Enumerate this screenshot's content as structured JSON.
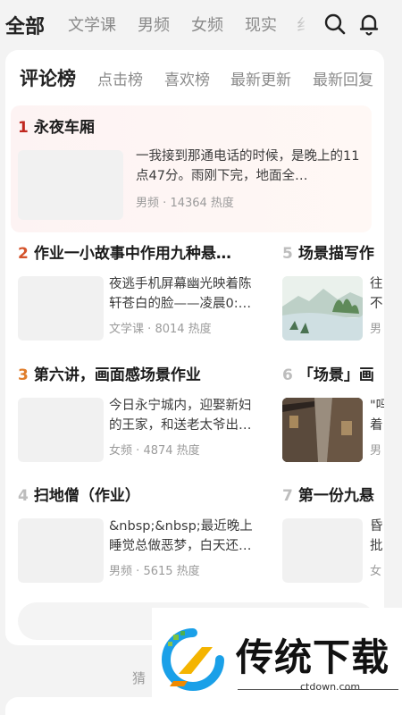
{
  "top_nav": {
    "categories": [
      "全部",
      "文学课",
      "男频",
      "女频",
      "现实",
      "纟"
    ]
  },
  "ranking": {
    "tabs": [
      "评论榜",
      "点击榜",
      "喜欢榜",
      "最新更新",
      "最新回复"
    ],
    "items": [
      {
        "rank": "1",
        "title": "永夜车厢",
        "desc": "一我接到那通电话的时候，是晚上的11点47分。雨刚下完，地面全…",
        "category": "男频",
        "heat": "14364 热度",
        "rank_color": "#c0271f"
      },
      {
        "rank": "2",
        "title": "作业一小故事中作用九种悬…",
        "desc": "夜逃手机屏幕幽光映着陈轩苍白的脸——凌晨0:…",
        "category": "文学课",
        "heat": "8014 热度",
        "rank_color": "#d4532b"
      },
      {
        "rank": "3",
        "title": "第六讲，画面感场景作业",
        "desc": "今日永宁城内，迎娶新妇的王家，和送老太爷出…",
        "category": "女频",
        "heat": "4874 热度",
        "rank_color": "#e07d2a"
      },
      {
        "rank": "4",
        "title": "扫地僧（作业）",
        "desc": "&nbsp;&nbsp;最近晚上睡觉总做恶梦，白天还…",
        "category": "男频",
        "heat": "5615 热度",
        "rank_color": "#bdbdbd"
      },
      {
        "rank": "5",
        "title": "场景描写作",
        "desc": "往不",
        "category": "男",
        "heat": "",
        "rank_color": "#bdbdbd"
      },
      {
        "rank": "6",
        "title": "「场景」画",
        "desc": "\"吗着",
        "category": "男",
        "heat": "",
        "rank_color": "#bdbdbd"
      },
      {
        "rank": "7",
        "title": "第一份九悬",
        "desc": "昏批",
        "category": "女",
        "heat": "",
        "rank_color": "#bdbdbd"
      }
    ],
    "separator": "·"
  },
  "guess_label": "猜",
  "watermark": {
    "title": "传统下载",
    "url": "ctdown.com"
  },
  "colors": {
    "page_bg": "#f3f3f3",
    "card_bg": "#ffffff",
    "highlight_bg": "#fdf3f3"
  }
}
